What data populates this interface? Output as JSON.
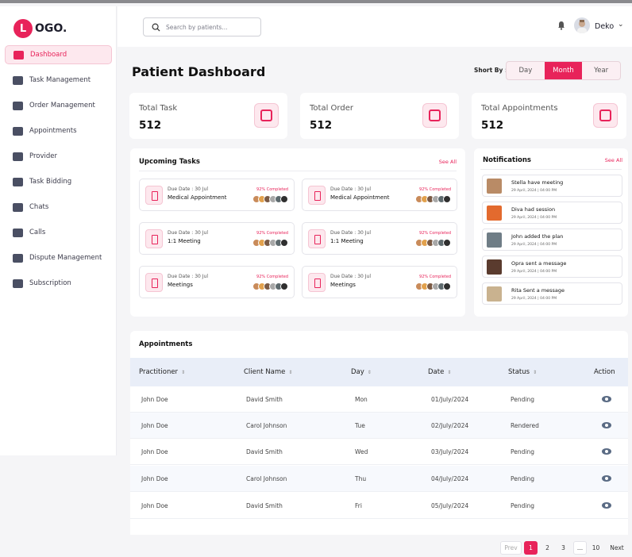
{
  "app": {
    "logo_letter": "L",
    "logo_text": "OGO."
  },
  "sidebar": {
    "items": [
      {
        "label": "Dashboard",
        "icon": "chart-icon",
        "active": true
      },
      {
        "label": "Task Management",
        "icon": "clipboard-icon"
      },
      {
        "label": "Order Management",
        "icon": "user-box-icon"
      },
      {
        "label": "Appointments",
        "icon": "calendar-icon"
      },
      {
        "label": "Provider",
        "icon": "user-add-icon"
      },
      {
        "label": "Task Bidding",
        "icon": "list-icon"
      },
      {
        "label": "Chats",
        "icon": "chat-icon"
      },
      {
        "label": "Calls",
        "icon": "phone-icon"
      },
      {
        "label": "Dispute Management",
        "icon": "people-icon"
      },
      {
        "label": "Subscription",
        "icon": "card-icon"
      }
    ]
  },
  "header": {
    "search_placeholder": "Search by patients...",
    "user_name": "Deko"
  },
  "page": {
    "title": "Patient Dashboard",
    "sort_label": "Short By :",
    "sort_options": [
      "Day",
      "Month",
      "Year"
    ],
    "sort_selected": "Month"
  },
  "stats": [
    {
      "label": "Total Task",
      "value": "512"
    },
    {
      "label": "Total Order",
      "value": "512"
    },
    {
      "label": "Total Appointments",
      "value": "512"
    }
  ],
  "upcoming": {
    "title": "Upcoming Tasks",
    "see_all": "See All",
    "tasks": [
      {
        "due": "Due Date : 30 Jul",
        "name": "Medical Appointment",
        "pct": "92% Completed"
      },
      {
        "due": "Due Date : 30 Jul",
        "name": "Medical Appointment",
        "pct": "92% Completed"
      },
      {
        "due": "Due Date : 30 Jul",
        "name": "1:1 Meeting",
        "pct": "92% Completed"
      },
      {
        "due": "Due Date : 30 Jul",
        "name": "1:1 Meeting",
        "pct": "92% Completed"
      },
      {
        "due": "Due Date : 30 Jul",
        "name": "Meetings",
        "pct": "92% Completed"
      },
      {
        "due": "Due Date : 30 Jul",
        "name": "Meetings",
        "pct": "92% Completed"
      }
    ]
  },
  "notifications": {
    "title": "Notifications",
    "see_all": "See All",
    "items": [
      {
        "text": "Stella have meeting",
        "time": "29 April, 2024 | 04:00 PM"
      },
      {
        "text": "Diva had session",
        "time": "29 April, 2024 | 04:00 PM"
      },
      {
        "text": "John added the plan",
        "time": "29 April, 2024 | 04:00 PM"
      },
      {
        "text": "Opra sent a  message",
        "time": "29 April, 2024 | 04:00 PM"
      },
      {
        "text": "Rita Sent a message",
        "time": "29 April, 2024 | 04:00 PM"
      }
    ]
  },
  "appointments": {
    "title": "Appointments",
    "columns": [
      "Practitioner",
      "Client Name",
      "Day",
      "Date",
      "Status",
      "Action"
    ],
    "rows": [
      [
        "John Doe",
        "David Smith",
        "Mon",
        "01/July/2024",
        "Pending"
      ],
      [
        "John Doe",
        "Carol Johnson",
        "Tue",
        "02/July/2024",
        "Rendered"
      ],
      [
        "John Doe",
        "David Smith",
        "Wed",
        "03/July/2024",
        "Pending"
      ],
      [
        "John Doe",
        "Carol Johnson",
        "Thu",
        "04/July/2024",
        "Pending"
      ],
      [
        "John Doe",
        "David Smith",
        "Fri",
        "05/July/2024",
        "Pending"
      ]
    ]
  },
  "pagination": {
    "prev": "Prev",
    "pages": [
      "1",
      "2",
      "3",
      "...",
      "10"
    ],
    "next": "Next",
    "current": "1"
  },
  "colors": {
    "accent": "#e8235a",
    "accent_soft": "#fde8ee",
    "table_head": "#e9eef8"
  }
}
